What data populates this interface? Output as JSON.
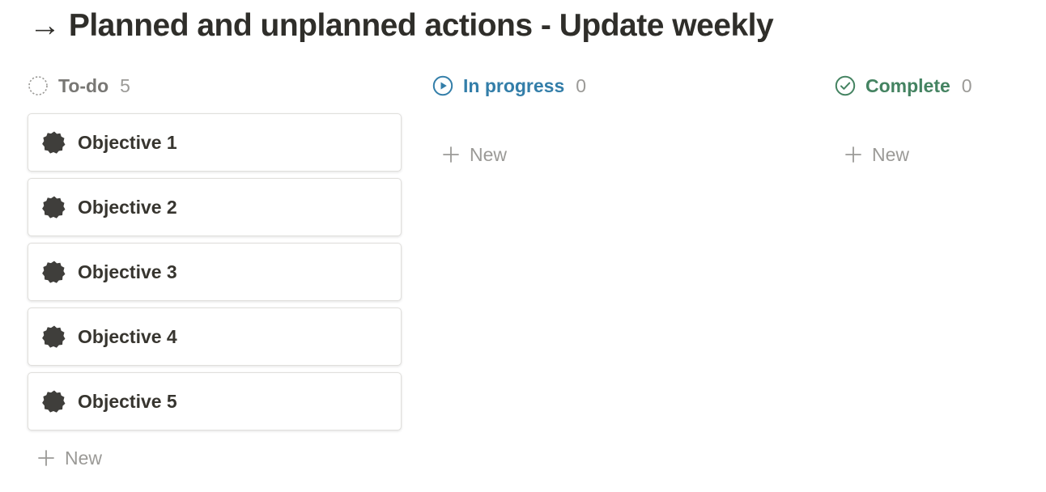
{
  "page": {
    "title": "→ Planned and unplanned actions - Update weekly"
  },
  "columns": [
    {
      "title": "To-do",
      "count": "5",
      "status_icon": "dotted-circle-icon",
      "color": "#787774",
      "cards": [
        {
          "title": "Objective 1",
          "icon": "badge-icon"
        },
        {
          "title": "Objective 2",
          "icon": "badge-icon"
        },
        {
          "title": "Objective 3",
          "icon": "badge-icon"
        },
        {
          "title": "Objective 4",
          "icon": "badge-icon"
        },
        {
          "title": "Objective 5",
          "icon": "badge-icon"
        }
      ],
      "new_label": "New"
    },
    {
      "title": "In progress",
      "count": "0",
      "status_icon": "play-circle-icon",
      "color": "#337ea9",
      "cards": [],
      "new_label": "New"
    },
    {
      "title": "Complete",
      "count": "0",
      "status_icon": "check-circle-icon",
      "color": "#448361",
      "cards": [],
      "new_label": "New"
    }
  ]
}
